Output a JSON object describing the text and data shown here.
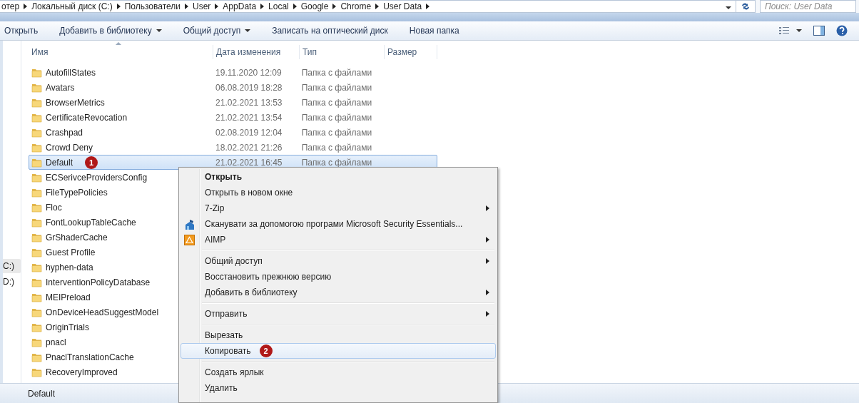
{
  "address_bar": {
    "path": [
      "отер",
      "Локальный диск (C:)",
      "Пользователи",
      "User",
      "AppData",
      "Local",
      "Google",
      "Chrome",
      "User Data"
    ],
    "search": {
      "placeholder": "Поиск: User Data"
    }
  },
  "toolbar": {
    "buttons": [
      {
        "label": "Открыть",
        "dropdown": false
      },
      {
        "label": "Добавить в библиотеку",
        "dropdown": true
      },
      {
        "label": "Общий доступ",
        "dropdown": true
      },
      {
        "label": "Записать на оптический диск",
        "dropdown": false
      },
      {
        "label": "Новая папка",
        "dropdown": false
      }
    ]
  },
  "nav_pane": {
    "items": [
      {
        "label": "C:)",
        "selected": true
      },
      {
        "label": "D:)",
        "selected": false
      }
    ]
  },
  "file_list": {
    "columns": [
      "Имя",
      "Дата изменения",
      "Тип",
      "Размер"
    ],
    "rows": [
      {
        "name": "AutofillStates",
        "modified": "19.11.2020 12:09",
        "type": "Папка с файлами",
        "selected": false
      },
      {
        "name": "Avatars",
        "modified": "06.08.2019 18:28",
        "type": "Папка с файлами",
        "selected": false
      },
      {
        "name": "BrowserMetrics",
        "modified": "21.02.2021 13:53",
        "type": "Папка с файлами",
        "selected": false
      },
      {
        "name": "CertificateRevocation",
        "modified": "21.02.2021 13:54",
        "type": "Папка с файлами",
        "selected": false
      },
      {
        "name": "Crashpad",
        "modified": "02.08.2019 12:04",
        "type": "Папка с файлами",
        "selected": false
      },
      {
        "name": "Crowd Deny",
        "modified": "18.02.2021 21:26",
        "type": "Папка с файлами",
        "selected": false
      },
      {
        "name": "Default",
        "modified": "21.02.2021 16:45",
        "type": "Папка с файлами",
        "selected": true,
        "badge": "1"
      },
      {
        "name": "ECSerivceProvidersConfig",
        "selected": false
      },
      {
        "name": "FileTypePolicies",
        "selected": false
      },
      {
        "name": "Floc",
        "selected": false
      },
      {
        "name": "FontLookupTableCache",
        "selected": false
      },
      {
        "name": "GrShaderCache",
        "selected": false
      },
      {
        "name": "Guest Profile",
        "selected": false
      },
      {
        "name": "hyphen-data",
        "selected": false
      },
      {
        "name": "InterventionPolicyDatabase",
        "selected": false
      },
      {
        "name": "MEIPreload",
        "selected": false
      },
      {
        "name": "OnDeviceHeadSuggestModel",
        "selected": false
      },
      {
        "name": "OriginTrials",
        "selected": false
      },
      {
        "name": "pnacl",
        "selected": false
      },
      {
        "name": "PnaclTranslationCache",
        "selected": false
      },
      {
        "name": "RecoveryImproved",
        "selected": false
      }
    ]
  },
  "context_menu": {
    "items": [
      {
        "kind": "item",
        "label": "Открыть",
        "default": true,
        "submenu": false,
        "hovered": false
      },
      {
        "kind": "item",
        "label": "Открыть в новом окне",
        "default": false,
        "submenu": false,
        "hovered": false
      },
      {
        "kind": "item",
        "label": "7-Zip",
        "default": false,
        "submenu": true,
        "hovered": false
      },
      {
        "kind": "scan",
        "label": "Сканувати за допомогою програми Microsoft Security Essentials...",
        "default": false,
        "submenu": false,
        "hovered": false
      },
      {
        "kind": "player",
        "label": "AIMP",
        "default": false,
        "submenu": true,
        "hovered": false
      },
      {
        "kind": "separator"
      },
      {
        "kind": "item",
        "label": "Общий доступ",
        "default": false,
        "submenu": true,
        "hovered": false
      },
      {
        "kind": "item",
        "label": "Восстановить прежнюю версию",
        "default": false,
        "submenu": false,
        "hovered": false
      },
      {
        "kind": "item",
        "label": "Добавить в библиотеку",
        "default": false,
        "submenu": true,
        "hovered": false
      },
      {
        "kind": "separator"
      },
      {
        "kind": "item",
        "label": "Отправить",
        "default": false,
        "submenu": true,
        "hovered": false
      },
      {
        "kind": "separator"
      },
      {
        "kind": "item",
        "label": "Вырезать",
        "default": false,
        "submenu": false,
        "hovered": false
      },
      {
        "kind": "item",
        "label": "Копировать",
        "default": false,
        "submenu": false,
        "hovered": true,
        "badge": "2"
      },
      {
        "kind": "separator"
      },
      {
        "kind": "item",
        "label": "Создать ярлык",
        "default": false,
        "submenu": false,
        "hovered": false
      },
      {
        "kind": "item",
        "label": "Удалить",
        "default": false,
        "submenu": false,
        "hovered": false
      }
    ]
  },
  "status_bar": {
    "text": "Default"
  }
}
